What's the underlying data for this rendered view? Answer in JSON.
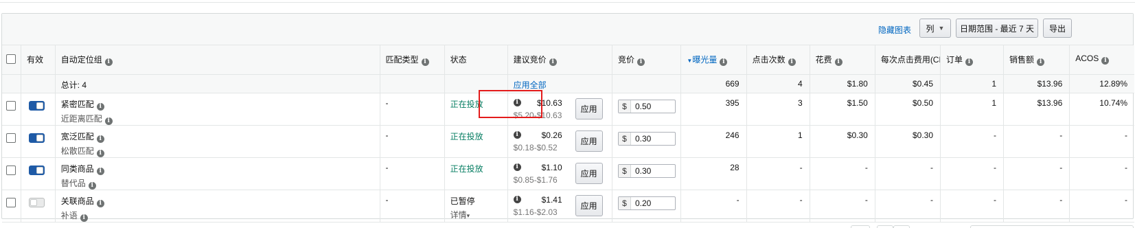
{
  "toolbar": {
    "hide_chart": "隐藏图表",
    "columns": "列",
    "date_range": "日期范围 - 最近 7 天",
    "export": "导出"
  },
  "headers": {
    "active": "有效",
    "targeting_group": "自动定位组",
    "match_type": "匹配类型",
    "status": "状态",
    "suggested_bid": "建议竞价",
    "bid": "竞价",
    "impressions": "曝光量",
    "clicks": "点击次数",
    "spend": "花费",
    "cpc": "每次点击费用(CPC)",
    "orders": "订单",
    "sales": "销售额",
    "acos": "ACOS"
  },
  "total": {
    "label": "总计: 4",
    "apply_all": "应用全部",
    "impressions": "669",
    "clicks": "4",
    "spend": "$1.80",
    "cpc": "$0.45",
    "orders": "1",
    "sales": "$13.96",
    "acos": "12.89%"
  },
  "rows": [
    {
      "active": true,
      "name": "紧密匹配",
      "sub": "近距离匹配",
      "match_type": "-",
      "status": "正在投放",
      "status_detail": "",
      "suggested": "$10.63",
      "range": "$5.20-$10.63",
      "apply": "应用",
      "currency": "$",
      "bid": "0.50",
      "impressions": "395",
      "clicks": "3",
      "spend": "$1.50",
      "cpc": "$0.50",
      "orders": "1",
      "sales": "$13.96",
      "acos": "10.74%"
    },
    {
      "active": true,
      "name": "宽泛匹配",
      "sub": "松散匹配",
      "match_type": "-",
      "status": "正在投放",
      "status_detail": "",
      "suggested": "$0.26",
      "range": "$0.18-$0.52",
      "apply": "应用",
      "currency": "$",
      "bid": "0.30",
      "impressions": "246",
      "clicks": "1",
      "spend": "$0.30",
      "cpc": "$0.30",
      "orders": "-",
      "sales": "-",
      "acos": "-"
    },
    {
      "active": true,
      "name": "同类商品",
      "sub": "替代品",
      "match_type": "-",
      "status": "正在投放",
      "status_detail": "",
      "suggested": "$1.10",
      "range": "$0.85-$1.76",
      "apply": "应用",
      "currency": "$",
      "bid": "0.30",
      "impressions": "28",
      "clicks": "-",
      "spend": "-",
      "cpc": "-",
      "orders": "-",
      "sales": "-",
      "acos": "-"
    },
    {
      "active": false,
      "name": "关联商品",
      "sub": "补语",
      "match_type": "-",
      "status": "已暂停",
      "status_detail": "详情",
      "suggested": "$1.41",
      "range": "$1.16-$2.03",
      "apply": "应用",
      "currency": "$",
      "bid": "0.20",
      "impressions": "-",
      "clicks": "-",
      "spend": "-",
      "cpc": "-",
      "orders": "-",
      "sales": "-",
      "acos": "-"
    }
  ],
  "colors": {
    "accent": "#0066c0",
    "active_toggle": "#1e5aa6",
    "status_green": "#067d62",
    "highlight": "#e31b1b"
  }
}
